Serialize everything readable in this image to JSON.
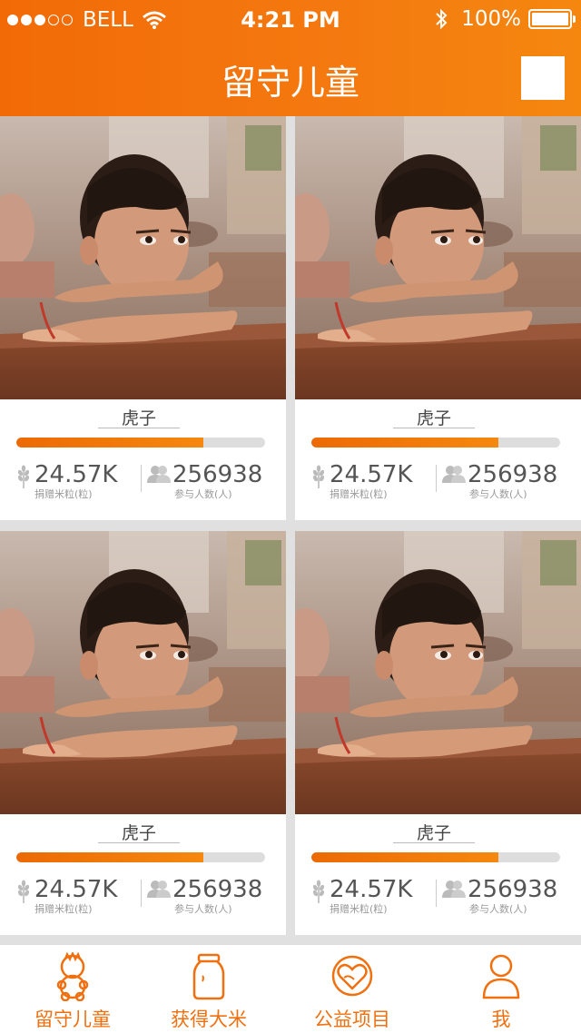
{
  "status": {
    "carrier": "BELL",
    "time": "4:21 PM",
    "battery": "100%"
  },
  "header": {
    "title": "留守儿童"
  },
  "cards": [
    {
      "name": "虎子",
      "progress": 0.75,
      "rice": "24.57K",
      "rice_label": "捐赠米粒(粒)",
      "people": "256938",
      "people_label": "参与人数(人)"
    },
    {
      "name": "虎子",
      "progress": 0.75,
      "rice": "24.57K",
      "rice_label": "捐赠米粒(粒)",
      "people": "256938",
      "people_label": "参与人数(人)"
    },
    {
      "name": "虎子",
      "progress": 0.75,
      "rice": "24.57K",
      "rice_label": "捐赠米粒(粒)",
      "people": "256938",
      "people_label": "参与人数(人)"
    },
    {
      "name": "虎子",
      "progress": 0.75,
      "rice": "24.57K",
      "rice_label": "捐赠米粒(粒)",
      "people": "256938",
      "people_label": "参与人数(人)"
    }
  ],
  "tabs": [
    {
      "label": "留守儿童",
      "icon": "child-icon"
    },
    {
      "label": "获得大米",
      "icon": "rice-jar-icon"
    },
    {
      "label": "公益项目",
      "icon": "heart-hands-icon"
    },
    {
      "label": "我",
      "icon": "person-icon"
    }
  ],
  "colors": {
    "accent": "#f26a06",
    "tab_text": "#f07010"
  }
}
